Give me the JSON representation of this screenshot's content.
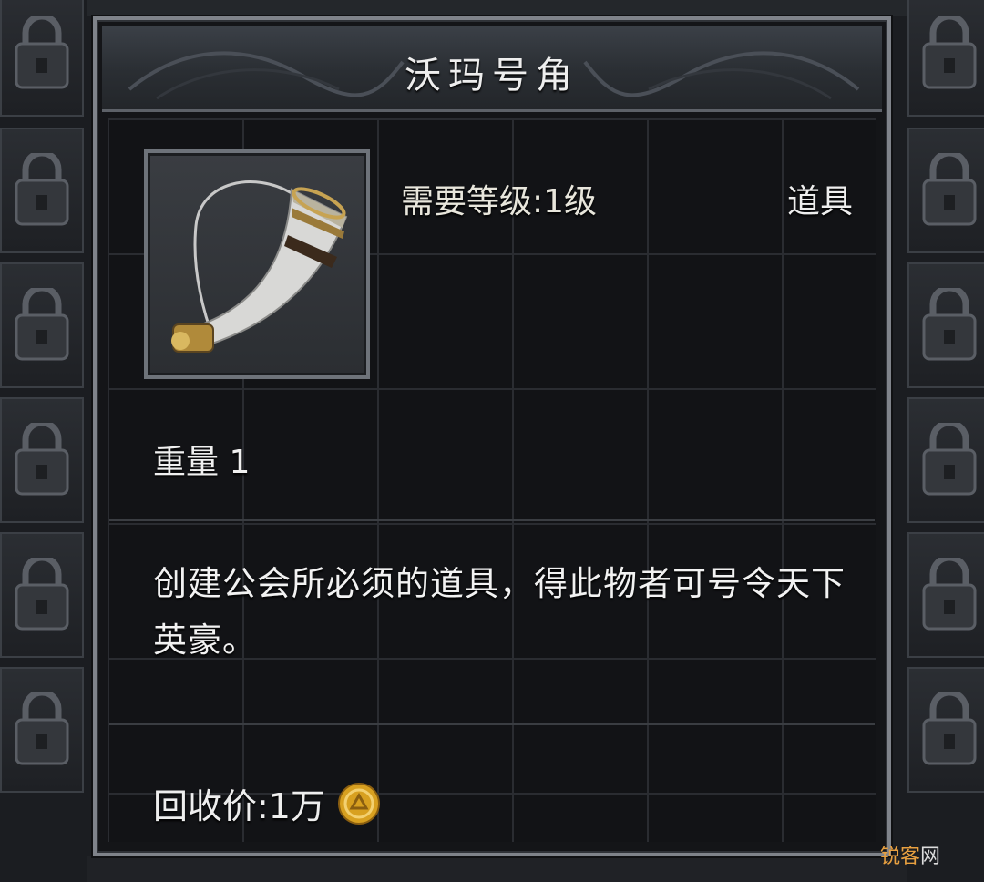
{
  "tooltip": {
    "title": "沃玛号角",
    "required_level": "需要等级:1级",
    "item_type": "道具",
    "weight": "重量 1",
    "description": "创建公会所必须的道具，得此物者可号令天下英豪。",
    "recycle_price": "回收价:1万",
    "item_icon": "horn-icon",
    "currency_icon": "gold-coin-icon"
  },
  "watermark": {
    "part1": "锐客",
    "part2": "网"
  },
  "colors": {
    "panel_border": "#7f838a",
    "panel_bg": "#141518",
    "coin_gold": "#d8a020"
  }
}
